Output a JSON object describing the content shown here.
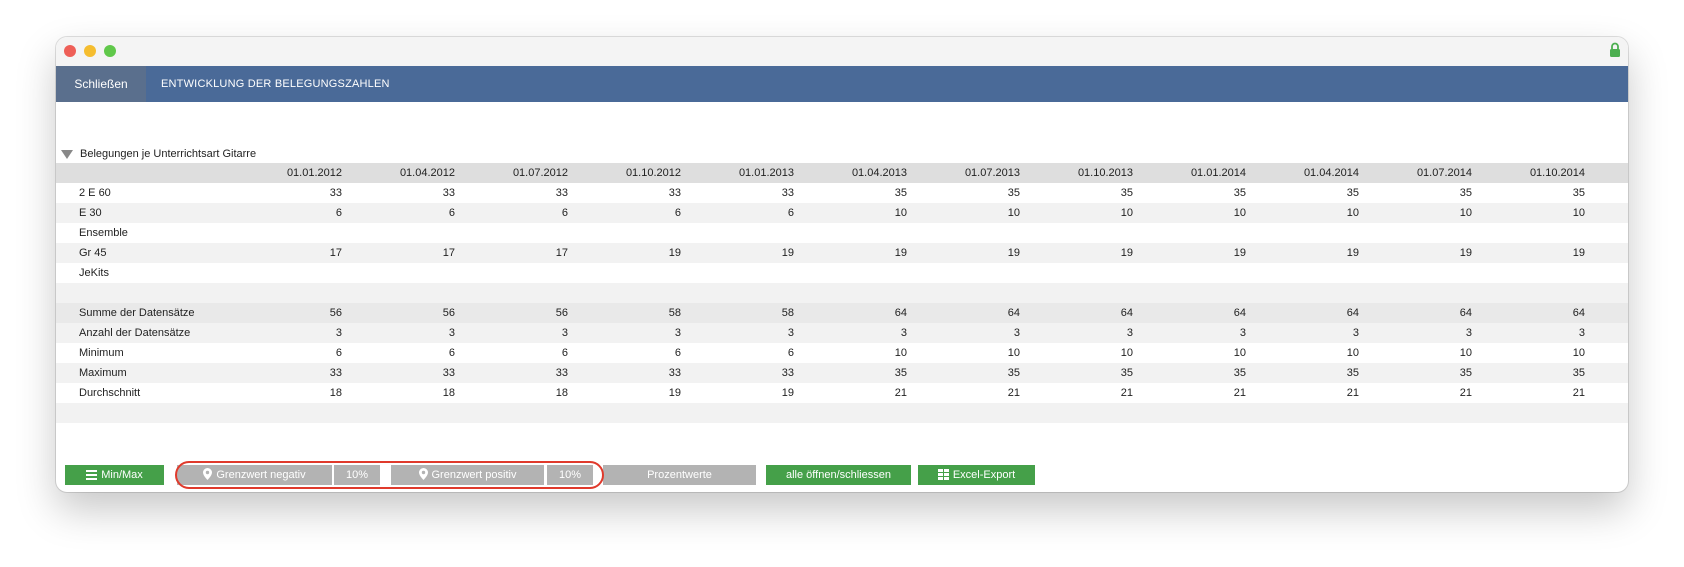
{
  "header": {
    "close_label": "Schließen",
    "title": "ENTWICKLUNG DER BELEGUNGSZAHLEN"
  },
  "section": {
    "label": "Belegungen je Unterrichtsart Gitarre"
  },
  "table": {
    "columns": [
      "01.01.2012",
      "01.04.2012",
      "01.07.2012",
      "01.10.2012",
      "01.01.2013",
      "01.04.2013",
      "01.07.2013",
      "01.10.2013",
      "01.01.2014",
      "01.04.2014",
      "01.07.2014",
      "01.10.2014"
    ],
    "rows": [
      {
        "label": "2 E 60",
        "values": [
          "33",
          "33",
          "33",
          "33",
          "33",
          "35",
          "35",
          "35",
          "35",
          "35",
          "35",
          "35"
        ]
      },
      {
        "label": "E 30",
        "values": [
          "6",
          "6",
          "6",
          "6",
          "6",
          "10",
          "10",
          "10",
          "10",
          "10",
          "10",
          "10"
        ]
      },
      {
        "label": "Ensemble",
        "values": [
          "",
          "",
          "",
          "",
          "",
          "",
          "",
          "",
          "",
          "",
          "",
          ""
        ]
      },
      {
        "label": "Gr 45",
        "values": [
          "17",
          "17",
          "17",
          "19",
          "19",
          "19",
          "19",
          "19",
          "19",
          "19",
          "19",
          "19"
        ]
      },
      {
        "label": "JeKits",
        "values": [
          "",
          "",
          "",
          "",
          "",
          "",
          "",
          "",
          "",
          "",
          "",
          ""
        ]
      }
    ],
    "summary": [
      {
        "label": "Summe der Datensätze",
        "values": [
          "56",
          "56",
          "56",
          "58",
          "58",
          "64",
          "64",
          "64",
          "64",
          "64",
          "64",
          "64"
        ]
      },
      {
        "label": "Anzahl der Datensätze",
        "values": [
          "3",
          "3",
          "3",
          "3",
          "3",
          "3",
          "3",
          "3",
          "3",
          "3",
          "3",
          "3"
        ]
      },
      {
        "label": "Minimum",
        "values": [
          "6",
          "6",
          "6",
          "6",
          "6",
          "10",
          "10",
          "10",
          "10",
          "10",
          "10",
          "10"
        ]
      },
      {
        "label": "Maximum",
        "values": [
          "33",
          "33",
          "33",
          "33",
          "33",
          "35",
          "35",
          "35",
          "35",
          "35",
          "35",
          "35"
        ]
      },
      {
        "label": "Durchschnitt",
        "values": [
          "18",
          "18",
          "18",
          "19",
          "19",
          "21",
          "21",
          "21",
          "21",
          "21",
          "21",
          "21"
        ]
      }
    ]
  },
  "toolbar": {
    "minmax_label": "Min/Max",
    "grenz_neg_label": "Grenzwert negativ",
    "grenz_neg_value": "10%",
    "grenz_pos_label": "Grenzwert positiv",
    "grenz_pos_value": "10%",
    "prozent_label": "Prozentwerte",
    "toggle_label": "alle öffnen/schliessen",
    "export_label": "Excel-Export"
  },
  "colors": {
    "header_bg": "#4a6a98",
    "button_green": "#45a049",
    "button_gray": "#b3b3b3",
    "highlight": "#e03a2c"
  },
  "icons": {
    "lock": "lock-icon",
    "menu": "hamburger-icon",
    "pin": "map-pin-icon",
    "grid": "grid-icon",
    "toggle": "triangle-down-icon"
  }
}
